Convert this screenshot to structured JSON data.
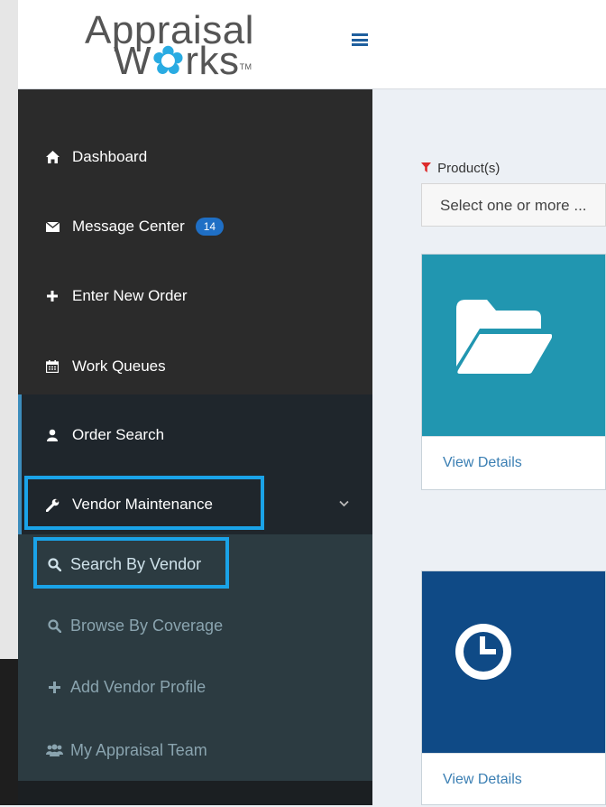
{
  "logo": {
    "line1": "Appraisal",
    "line2_pre": "W",
    "line2_gear": "✿",
    "line2_post": "rks",
    "tm": "TM"
  },
  "header": {
    "menu_icon": "hamburger-icon"
  },
  "sidebar": {
    "items": [
      {
        "label": "Dashboard",
        "icon": "home-icon"
      },
      {
        "label": "Message Center",
        "icon": "envelope-icon",
        "badge": "14"
      },
      {
        "label": "Enter New Order",
        "icon": "plus-icon"
      },
      {
        "label": "Work Queues",
        "icon": "calendar-icon"
      },
      {
        "label": "Order Search",
        "icon": "user-icon"
      },
      {
        "label": "Vendor Maintenance",
        "icon": "wrench-icon",
        "expanded": true
      }
    ],
    "sub_items": [
      {
        "label": "Search By Vendor",
        "icon": "search-icon"
      },
      {
        "label": "Browse By Coverage",
        "icon": "search-icon"
      },
      {
        "label": "Add Vendor Profile",
        "icon": "plus-icon"
      },
      {
        "label": "My Appraisal Team",
        "icon": "users-icon"
      }
    ]
  },
  "filter": {
    "label": "Product(s)",
    "placeholder": "Select one or more ..."
  },
  "cards": [
    {
      "icon": "folder-open-icon",
      "link": "View Details",
      "color": "#2196b0"
    },
    {
      "icon": "clock-icon",
      "link": "View Details",
      "color": "#0f4a86"
    }
  ],
  "colors": {
    "highlight": "#1aa3e8",
    "badge": "#1f6fc5",
    "sidebar": "#2b2b2b",
    "submenu": "#2c3b41"
  }
}
